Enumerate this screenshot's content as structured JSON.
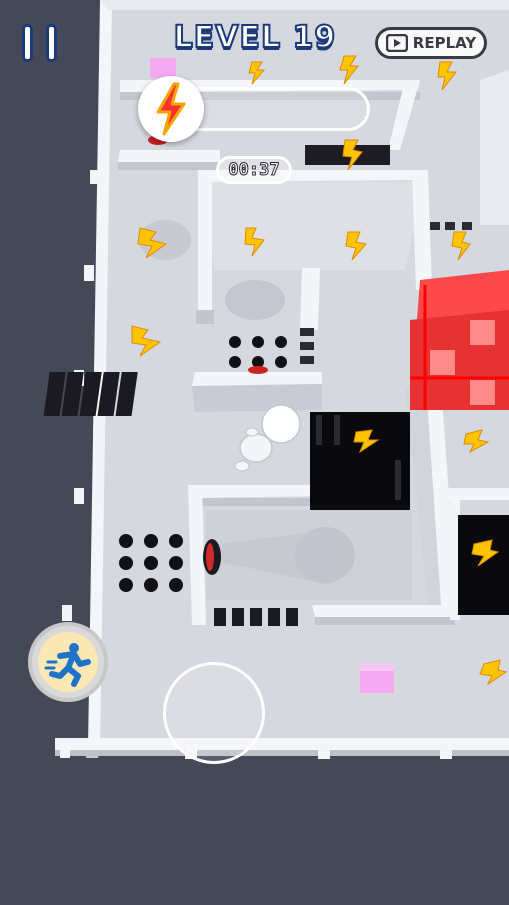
{
  "hud": {
    "level_title": "LEVEL 19",
    "replay_label": "REPLAY",
    "timer": "00:37",
    "energy_fraction": 0.0
  },
  "colors": {
    "background": "#454857",
    "floor": "#d8d9e0",
    "wall_top": "#f4f5f8",
    "wall_side": "#c4c6cf",
    "laser_red": "#ff2a2a",
    "lightning": "#ffc400",
    "pink_gem": "#f4a9f0",
    "player": "#ffffff",
    "ui_outline": "#1c3a7a"
  },
  "icons": {
    "pause": "pause-icon",
    "replay": "play-icon",
    "energy": "lightning-bolt-icon",
    "sprint": "running-man-icon"
  }
}
